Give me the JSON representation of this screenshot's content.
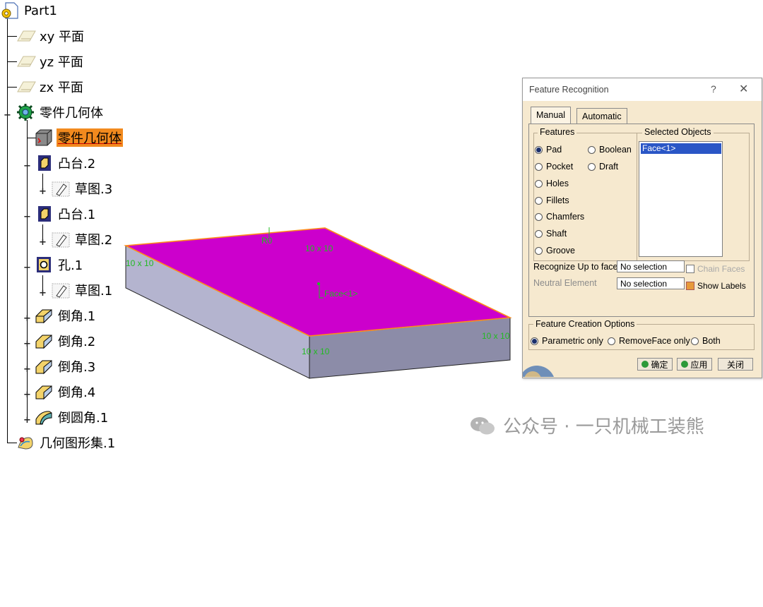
{
  "tree": {
    "root": "Part1",
    "planes": [
      "xy 平面",
      "yz 平面",
      "zx 平面"
    ],
    "body": "零件几何体",
    "body_selected": "零件几何体",
    "features": [
      {
        "label": "凸台.2",
        "child": "草图.3"
      },
      {
        "label": "凸台.1",
        "child": "草图.2"
      },
      {
        "label": "孔.1",
        "child": "草图.1"
      }
    ],
    "chamfers": [
      "倒角.1",
      "倒角.2",
      "倒角.3",
      "倒角.4"
    ],
    "fillet": "倒圆角.1",
    "geoset": "几何图形集.1"
  },
  "viewport": {
    "dims": [
      "R0",
      "10 x 10",
      "10 x 10",
      "10 x 10",
      "10 x 10"
    ],
    "face_label": "Face<1>",
    "colors": {
      "top": "#cc00cc",
      "front": "#8c8ca8",
      "side": "#b4b4cf",
      "edge_highlight": "#ff8c1a"
    }
  },
  "dialog": {
    "title": "Feature Recognition",
    "help": "?",
    "close": "✕",
    "tabs": [
      "Manual",
      "Automatic"
    ],
    "features_group": "Features",
    "features_left": [
      "Pad",
      "Pocket",
      "Holes",
      "Fillets",
      "Chamfers",
      "Shaft",
      "Groove"
    ],
    "features_right": [
      "Boolean",
      "Draft"
    ],
    "selected_feature": "Pad",
    "selected_group": "Selected Objects",
    "selected_items": [
      "Face<1>"
    ],
    "recognize_label": "Recognize Up to face",
    "recognize_value": "No selection",
    "chain_faces": "Chain Faces",
    "neutral_label": "Neutral Element",
    "neutral_value": "No selection",
    "show_labels": "Show Labels",
    "options_group": "Feature Creation Options",
    "options": [
      "Parametric only",
      "RemoveFace only",
      "Both"
    ],
    "buttons": [
      "确定",
      "应用",
      "关闭"
    ]
  },
  "watermark": "公众号 · 一只机械工装熊"
}
